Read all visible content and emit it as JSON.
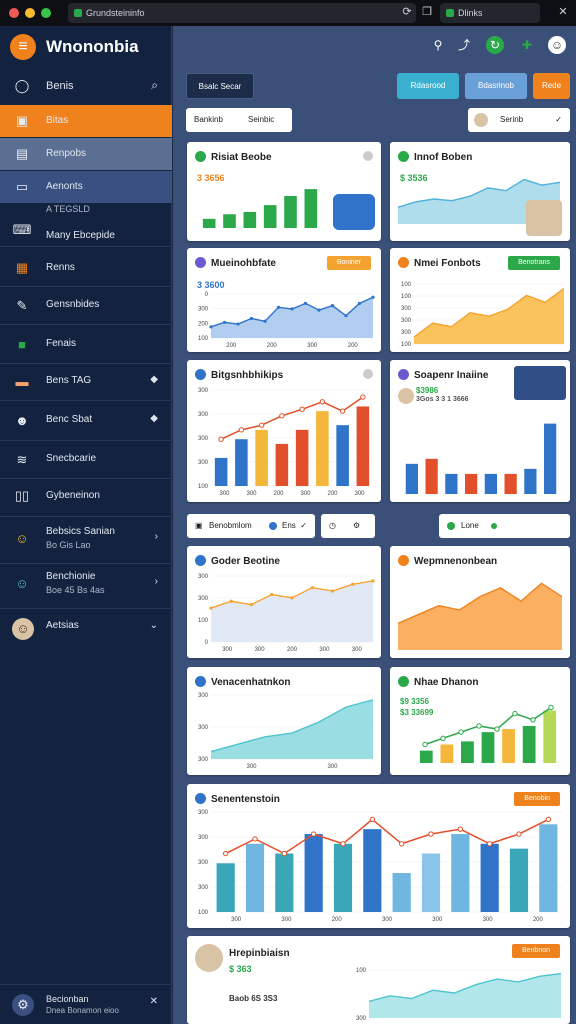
{
  "titlebar": {
    "tab1": "Grundsteininfo",
    "tab2": "Dlinks"
  },
  "sidebar": {
    "brand": "Wnononbia",
    "search_label": "Benis",
    "items": [
      {
        "label": "Bitas",
        "icon": "briefcase-icon"
      },
      {
        "label": "Renpobs",
        "icon": "document-icon"
      },
      {
        "label": "Aenonts",
        "icon": "card-icon"
      },
      {
        "label": "Many Ebcepide",
        "sub": "A TEGSLD",
        "icon": "laptop-icon"
      },
      {
        "label": "Renns",
        "icon": "image-icon"
      },
      {
        "label": "Gensnbides",
        "icon": "user-edit-icon"
      },
      {
        "label": "Fenais",
        "icon": "chat-icon"
      },
      {
        "label": "Bens TAG",
        "icon": "card-icon"
      },
      {
        "label": "Benc Sbat",
        "icon": "people-icon"
      },
      {
        "label": "Snecbcarie",
        "icon": "wifi-icon"
      },
      {
        "label": "Gybeneinon",
        "icon": "book-icon"
      },
      {
        "label": "Bebsics Sanian",
        "sub": "Bo Gis Lao",
        "icon": "avatar-icon"
      },
      {
        "label": "Benchionie",
        "sub": "Boe 45 Bs 4as",
        "icon": "avatar-icon"
      },
      {
        "label": "Aetsias",
        "icon": "avatar-icon"
      }
    ],
    "footer": {
      "label": "Becionban",
      "sub": "Dnea Bonamon eioo"
    }
  },
  "main": {
    "header_button": "Bsalc Secar",
    "action1": "Rdasrood",
    "action2": "Bdasrinob",
    "action3": "Rede",
    "seg1": "Bankinb",
    "seg2": "Seinbic",
    "select": "Serinb",
    "filter_label": "Benobmlom",
    "filter2": "Ens",
    "right_filter": "Lone"
  },
  "colors": {
    "accent": "#f0821e",
    "blue": "#2f74c8",
    "green": "#2aa84a",
    "teal": "#4fc4cf",
    "red": "#e2502b",
    "yellow": "#f5b73b"
  },
  "cards": [
    {
      "title": "Risiat Beobe",
      "stat": "3 3656",
      "badge": "#2aa84a"
    },
    {
      "title": "Innof Boben",
      "stat": "$ 3536",
      "badge": "#2aa84a"
    },
    {
      "title": "Mueinohbfate",
      "stat": "3 3600",
      "badge": "#6b5bd0",
      "pill": "Boniner"
    },
    {
      "title": "Nmei Fonbots",
      "badge": "#f0821e",
      "pill": "Benotrans"
    },
    {
      "title": "Bitgsnhbhikips",
      "badge": "#2f74c8"
    },
    {
      "title": "Soapenr Inaiine",
      "stat": "$3986",
      "stat2": "3Gos 3 3 1 3666",
      "badge": "#6b5bd0"
    },
    {
      "title": "Goder Beotine",
      "badge": "#2f74c8"
    },
    {
      "title": "Wepmnenonbean",
      "badge": "#f0821e"
    },
    {
      "title": "Venacenhatnkon",
      "badge": "#2f74c8"
    },
    {
      "title": "Nhae Dhanon",
      "stat": "$9 3356",
      "stat2": "$3 33699",
      "badge": "#2aa84a"
    },
    {
      "title": "Senentenstoin",
      "badge": "#2f74c8",
      "pill": "Benobin"
    },
    {
      "title": "Hrepinbiaisn",
      "stat": "$ 363",
      "stat2": "Baob 6S 3S3",
      "badge": "#2aa84a",
      "pill": "Benbnon"
    }
  ],
  "chart_data": [
    {
      "type": "bar",
      "values": [
        2,
        3,
        3.5,
        5,
        7,
        8.5
      ]
    },
    {
      "type": "area",
      "values": [
        3,
        4,
        4.5,
        4.2,
        5,
        6.5,
        6,
        8,
        7,
        7.5
      ]
    },
    {
      "type": "area",
      "values": [
        20,
        28,
        25,
        35,
        30,
        55,
        52,
        62,
        50,
        58,
        40,
        62,
        73
      ],
      "yticks": [
        0,
        300,
        200,
        100
      ],
      "xticks": [
        "200",
        "200",
        "300",
        "200"
      ]
    },
    {
      "type": "area",
      "values": [
        1,
        3,
        2.5,
        4.5,
        4,
        5,
        7,
        6,
        8
      ],
      "yticks": [
        "100",
        "100",
        "300",
        "300",
        "300",
        "100"
      ]
    },
    {
      "type": "bar",
      "values": [
        3,
        5,
        6,
        4.5,
        6,
        8,
        6.5,
        8.5
      ],
      "line": [
        5,
        6,
        6.5,
        7.5,
        8.2,
        9,
        8,
        9.5
      ],
      "yticks": [
        "300",
        "300",
        "300",
        "300",
        "100"
      ],
      "xticks": [
        "300",
        "300",
        "200",
        "300",
        "200",
        "300"
      ]
    },
    {
      "type": "bar",
      "values": [
        3,
        3.5,
        2,
        2,
        2,
        2,
        2.5,
        7
      ]
    },
    {
      "type": "area",
      "values": [
        5,
        6,
        5.5,
        7,
        6.5,
        8,
        7.5,
        8.5,
        9
      ],
      "yticks": [
        "300",
        "300",
        "100",
        "0"
      ],
      "xticks": [
        "300",
        "300",
        "200",
        "300",
        "300"
      ]
    },
    {
      "type": "area",
      "values": [
        3,
        4,
        5,
        4.5,
        6,
        7,
        5.5,
        7.5,
        6
      ]
    },
    {
      "type": "area",
      "values": [
        1,
        2,
        3,
        3.5,
        5,
        7,
        8
      ],
      "yticks": [
        "300",
        "300",
        "300"
      ],
      "xticks": [
        "300",
        "300"
      ]
    },
    {
      "type": "bar",
      "values": [
        2,
        3,
        3.5,
        5,
        5.5,
        6,
        8.5
      ],
      "line": [
        3,
        4,
        5,
        6,
        5.5,
        8,
        7,
        9
      ]
    },
    {
      "type": "bar",
      "values": [
        5,
        7,
        6,
        8,
        7,
        8.5,
        4,
        6,
        8,
        7,
        6.5,
        9
      ],
      "line": [
        6,
        7.5,
        6,
        8,
        7,
        9.5,
        7,
        8,
        8.5,
        7,
        8,
        9.5
      ],
      "yticks": [
        "300",
        "300",
        "300",
        "300",
        "100"
      ],
      "xticks": [
        "300",
        "300",
        "200",
        "300",
        "300",
        "300",
        "200"
      ]
    },
    {
      "type": "area",
      "values": [
        3,
        4,
        3.5,
        5,
        4.5,
        6,
        7,
        6.5,
        7.5,
        8
      ],
      "yticks": [
        "100",
        "300"
      ]
    }
  ]
}
